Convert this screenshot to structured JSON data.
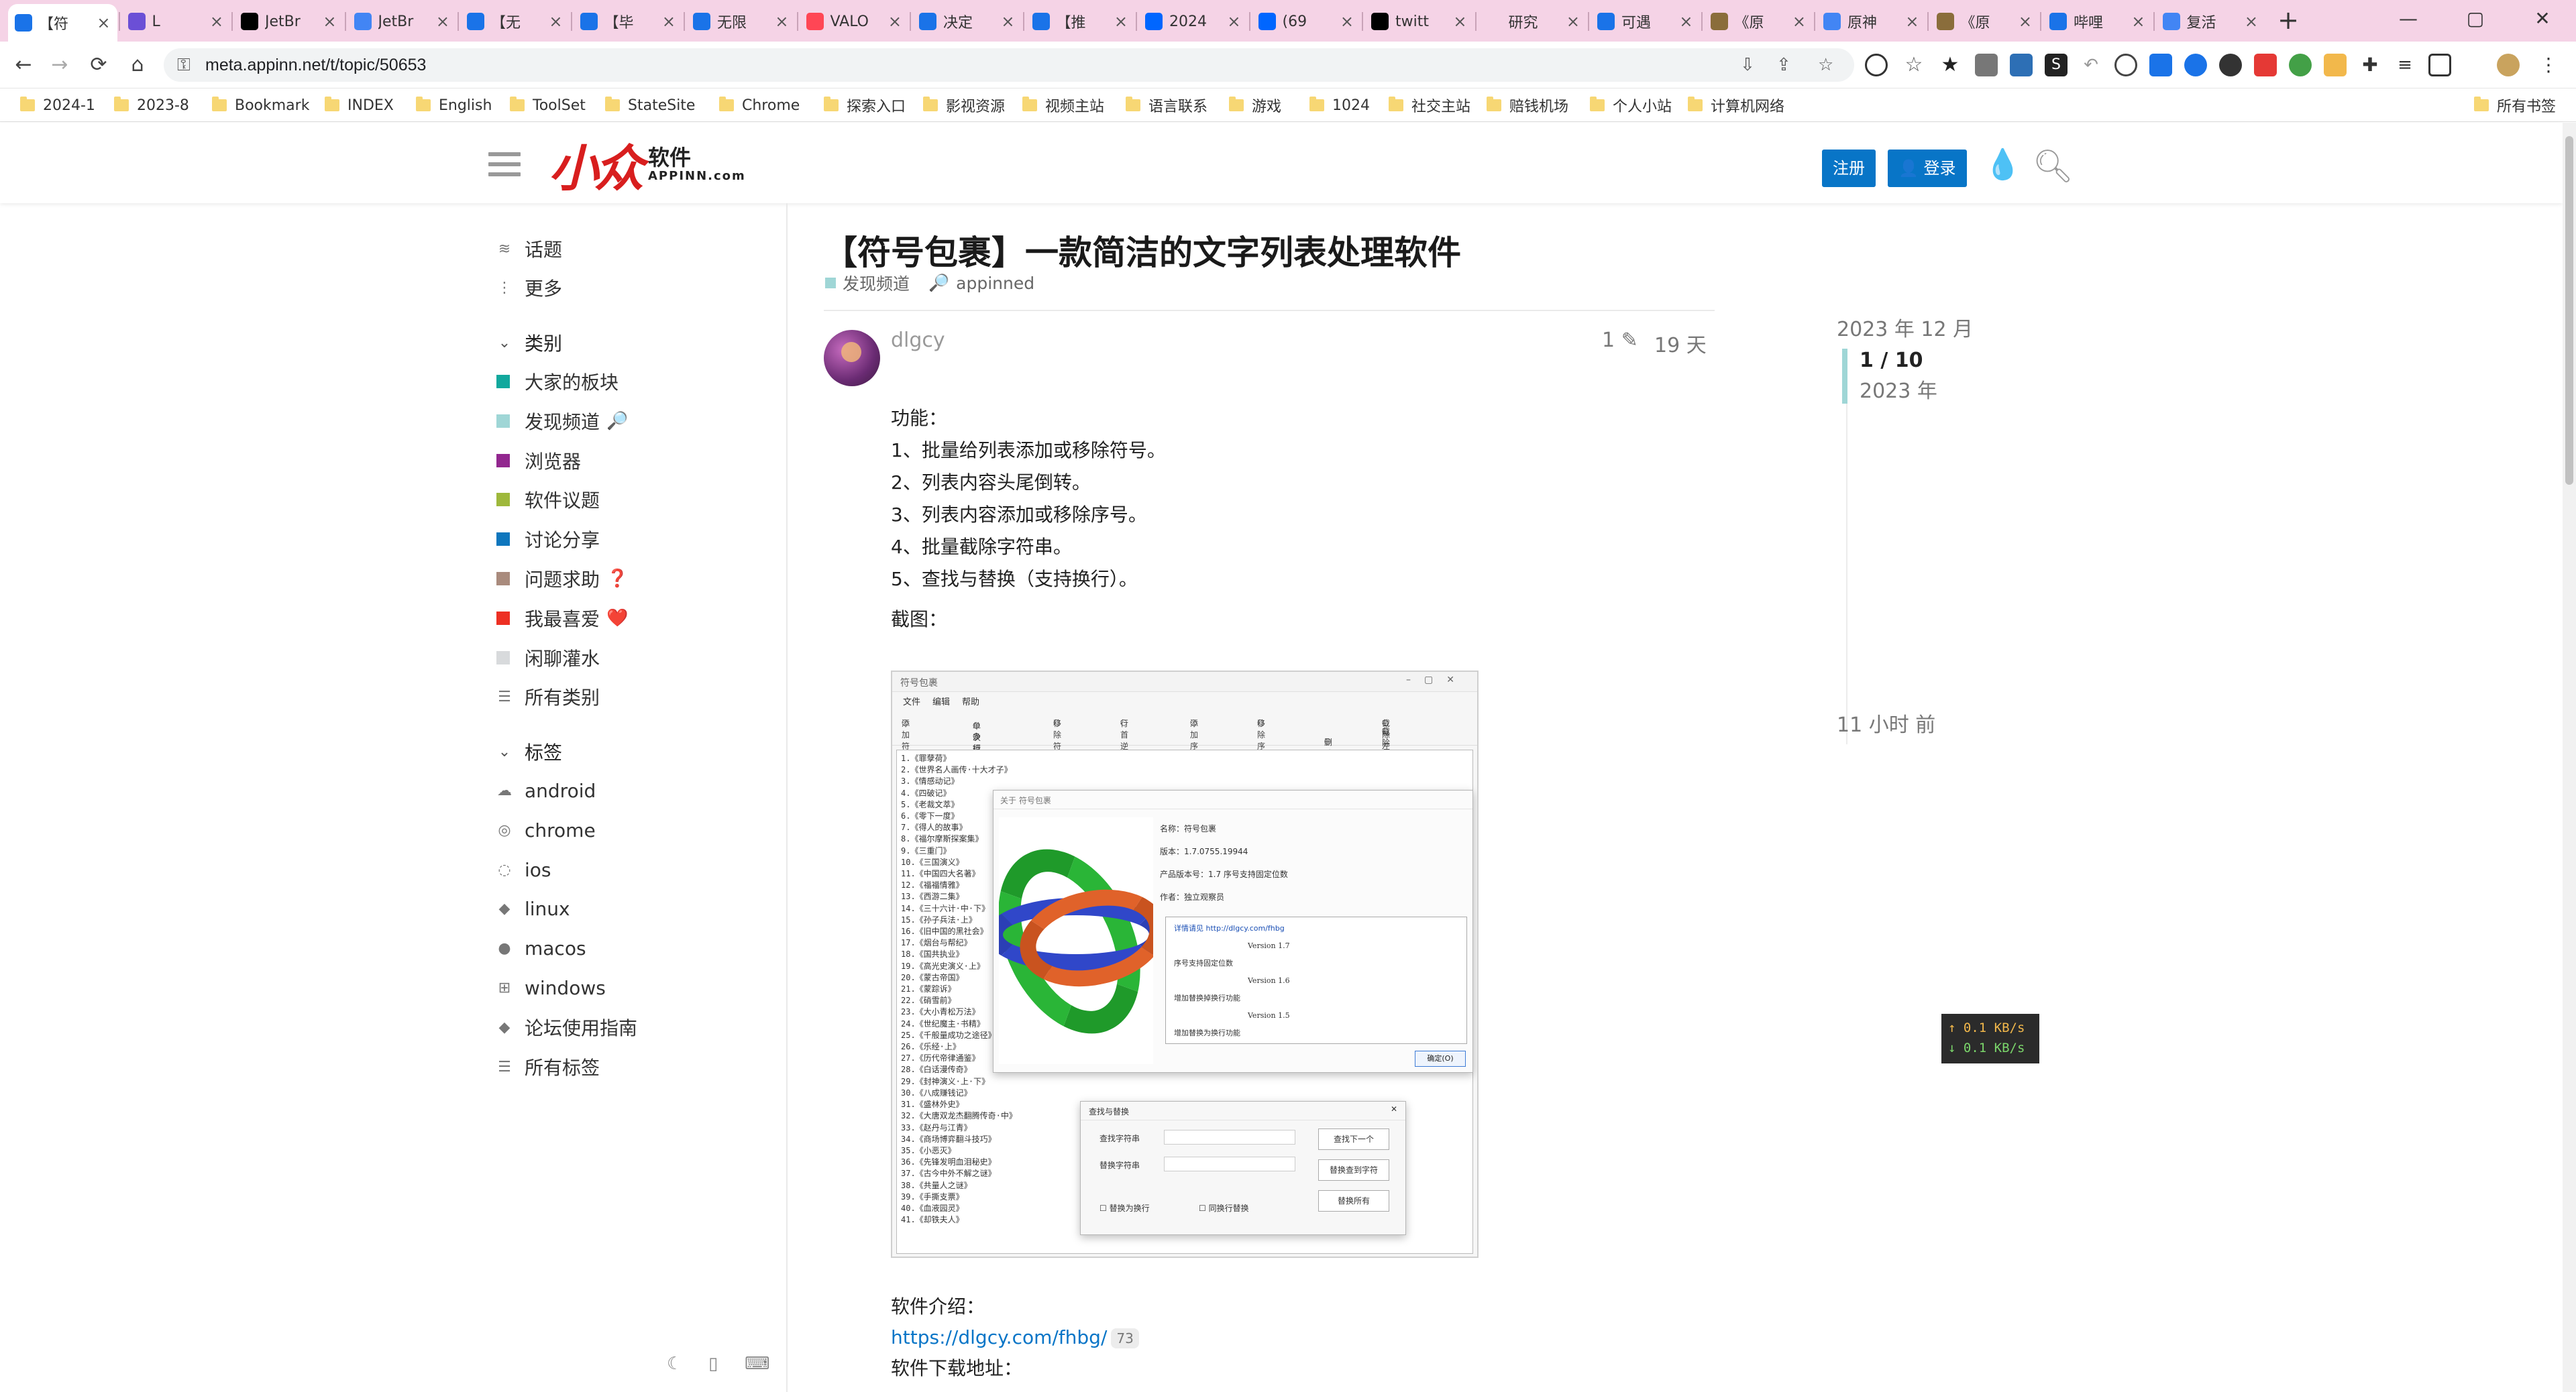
{
  "browser": {
    "tabs": [
      {
        "title": "【符",
        "favicon_color": "#1a73e8",
        "active": true
      },
      {
        "title": "L",
        "favicon_color": "#6b4fd6"
      },
      {
        "title": "JetBr",
        "favicon_color": "#000000"
      },
      {
        "title": "JetBr",
        "favicon_color": "#4285f4"
      },
      {
        "title": "【无",
        "favicon_color": "#1a73e8"
      },
      {
        "title": "【毕",
        "favicon_color": "#1a73e8"
      },
      {
        "title": "无限",
        "favicon_color": "#1a73e8"
      },
      {
        "title": "VALO",
        "favicon_color": "#ff4655"
      },
      {
        "title": "决定",
        "favicon_color": "#1a73e8"
      },
      {
        "title": "【推",
        "favicon_color": "#1a73e8"
      },
      {
        "title": "2024",
        "favicon_color": "#0066ff"
      },
      {
        "title": "(69",
        "favicon_color": "#0066ff"
      },
      {
        "title": "twitt",
        "favicon_color": "#000000"
      },
      {
        "title": "研究",
        "favicon_color": "#f5d3e6"
      },
      {
        "title": "可遇",
        "favicon_color": "#1a73e8"
      },
      {
        "title": "《原",
        "favicon_color": "#8a6d3b"
      },
      {
        "title": "原神",
        "favicon_color": "#4285f4"
      },
      {
        "title": "《原",
        "favicon_color": "#8a6d3b"
      },
      {
        "title": "哔哩",
        "favicon_color": "#1a73e8"
      },
      {
        "title": "复活",
        "favicon_color": "#4285f4"
      }
    ],
    "url": "meta.appinn.net/t/topic/50653",
    "bookmarks": [
      "2024-1",
      "2023-8",
      "Bookmark",
      "INDEX",
      "English",
      "ToolSet",
      "StateSite",
      "Chrome",
      "探索入口",
      "影视资源",
      "视频主站",
      "语言联系",
      "游戏",
      "1024",
      "社交主站",
      "赔钱机场",
      "个人小站",
      "计算机网络"
    ],
    "all_bookmarks": "所有书签"
  },
  "header": {
    "logo_cn": "软件",
    "logo_en": "APPINN.com",
    "signup": "注册",
    "login": "登录"
  },
  "sidebar": {
    "top_items": [
      {
        "label": "话题",
        "icon": "layers-icon"
      },
      {
        "label": "更多",
        "icon": "more-vertical-icon"
      }
    ],
    "categories_title": "类别",
    "categories": [
      {
        "label": "大家的板块",
        "color": "#12a89d",
        "emoji": ""
      },
      {
        "label": "发现频道",
        "color": "#9fd6d6",
        "emoji": "🔎"
      },
      {
        "label": "浏览器",
        "color": "#92278f",
        "emoji": ""
      },
      {
        "label": "软件议题",
        "color": "#9eb83b",
        "emoji": ""
      },
      {
        "label": "讨论分享",
        "color": "#0e76bd",
        "emoji": ""
      },
      {
        "label": "问题求助",
        "color": "#a98b7d",
        "emoji": "❓"
      },
      {
        "label": "我最喜爱",
        "color": "#ed3023",
        "emoji": "❤️"
      },
      {
        "label": "闲聊灌水",
        "color": "#d8dadc",
        "emoji": ""
      }
    ],
    "all_categories": "所有类别",
    "tags_title": "标签",
    "tags": [
      {
        "label": "android",
        "icon": "android-icon"
      },
      {
        "label": "chrome",
        "icon": "chrome-icon"
      },
      {
        "label": "ios",
        "icon": "ios-icon"
      },
      {
        "label": "linux",
        "icon": "tag-icon"
      },
      {
        "label": "macos",
        "icon": "apple-icon"
      },
      {
        "label": "windows",
        "icon": "windows-icon"
      },
      {
        "label": "论坛使用指南",
        "icon": "tag-icon"
      }
    ],
    "all_tags": "所有标签"
  },
  "topic": {
    "title": "【符号包裹】一款简洁的文字列表处理软件",
    "category": "发现频道",
    "tag": "appinned",
    "author": "dlgcy",
    "edits": "1",
    "age": "19 天",
    "features_heading": "功能：",
    "features": [
      "1、批量给列表添加或移除符号。",
      "2、列表内容头尾倒转。",
      "3、列表内容添加或移除序号。",
      "4、批量截除字符串。",
      "5、查找与替换（支持换行）。"
    ],
    "screenshot_heading": "截图：",
    "intro_heading": "软件介绍：",
    "intro_link": "https://dlgcy.com/fhbg/",
    "intro_clicks": "73",
    "download_heading": "软件下载地址："
  },
  "app_screenshot": {
    "window_title": "符号包裹",
    "menu": [
      "文件",
      "编辑",
      "帮助"
    ],
    "options": [
      "添加符号",
      "单次模式",
      "多行模式",
      "移除符号",
      "行首逆转",
      "添加序号",
      "移除序号",
      "删除字符串",
      "截除左边",
      "截除右边"
    ],
    "list_items": [
      "1.《罪孽荷》",
      "2.《世界名人画传·十大才子》",
      "3.《情感动记》",
      "4.《四破记》",
      "5.《老裁文萃》",
      "6.《零下一度》",
      "7.《得人的故事》",
      "8.《福尔摩斯探案集》",
      "9.《三重门》",
      "10.《三国演义》",
      "11.《中国四大名著》",
      "12.《福福情雅》",
      "13.《西游二集》",
      "14.《三十六计·中·下》",
      "15.《孙子兵法·上》",
      "16.《旧中国的黑社会》",
      "17.《烟台与帮纪》",
      "18.《国共执业》",
      "19.《高光史演义·上》",
      "20.《蒙古帝国》",
      "21.《蒙踪诉》",
      "22.《硝雪前》",
      "23.《大小青松万法》",
      "24.《世纪魔主·书精》",
      "25.《千般量成功之途径》",
      "26.《乐经·上》",
      "27.《历代帝律通鉴》",
      "28.《白话漫传奇》",
      "29.《封神演义·上·下》",
      "30.《八成赚钱记》",
      "31.《盛林外史》",
      "32.《大唐双龙杰翻腾传奇·中》",
      "33.《赵丹与江青》",
      "34.《商场博弈翻斗技巧》",
      "35.《小恶灭》",
      "36.《先锋发明血泪秘史》",
      "37.《古今中外不解之谜》",
      "38.《共量人之谜》",
      "39.《手撕支票》",
      "40.《血液园灵》",
      "41.《却铁夫人》"
    ],
    "about_title": "关于 符号包裹",
    "about_info": [
      "名称：符号包裹",
      "版本：1.7.0755.19944",
      "产品版本号：1.7 序号支持固定位数",
      "作者：独立观察员"
    ],
    "about_notes": [
      "详情请见 http://dlgcy.com/fhbg",
      "Version 1.7",
      "序号支持固定位数",
      "Version 1.6",
      "增加替换掉换行功能",
      "Version 1.5",
      "增加替换为换行功能"
    ],
    "about_ok": "确定(O)",
    "find_title": "查找与替换",
    "find_label": "查找字符串",
    "replace_label": "替换字符串",
    "find_next": "查找下一个",
    "replace_next": "替换查到字符",
    "replace_all": "替换所有",
    "check_replace_newline": "替换为换行",
    "check_find_newline": "同换行替换"
  },
  "timeline": {
    "top_date": "2023 年 12 月",
    "progress_current": 1,
    "progress_total": 10,
    "progress_label": "1 / 10",
    "progress_year": "2023 年",
    "bottom_date": "11 小时 前"
  },
  "netspeed": {
    "up": "↑ 0.1 KB/s",
    "down": "↓ 0.1 KB/s"
  }
}
